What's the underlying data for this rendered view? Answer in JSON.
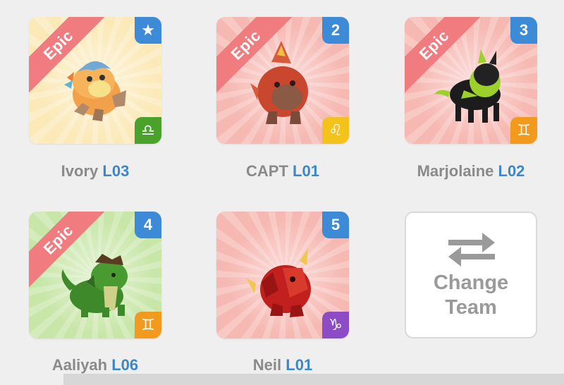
{
  "cards": [
    {
      "name": "Ivory",
      "level": "L03",
      "ribbon": "Epic",
      "badge": "★",
      "zodiac": "♎",
      "bg": "#fbe9b8",
      "badge_color": "#3d8bd6",
      "zodiac_color": "#4aa22c"
    },
    {
      "name": "CAPT",
      "level": "L01",
      "ribbon": "Epic",
      "badge": "2",
      "zodiac": "♌",
      "bg": "#f6b8b2",
      "badge_color": "#3d8bd6",
      "zodiac_color": "#f3c21b"
    },
    {
      "name": "Marjolaine",
      "level": "L02",
      "ribbon": "Epic",
      "badge": "3",
      "zodiac": "♊",
      "bg": "#f6b8b2",
      "badge_color": "#3d8bd6",
      "zodiac_color": "#f29a1e"
    },
    {
      "name": "Aaliyah",
      "level": "L06",
      "ribbon": "Epic",
      "badge": "4",
      "zodiac": "♊",
      "bg": "#c8e6a8",
      "badge_color": "#3d8bd6",
      "zodiac_color": "#f29a1e"
    },
    {
      "name": "Neil",
      "level": "L01",
      "ribbon": "",
      "badge": "5",
      "zodiac": "♑",
      "bg": "#f6b8b2",
      "badge_color": "#3d8bd6",
      "zodiac_color": "#8e4bc6"
    }
  ],
  "change_team": {
    "line1": "Change",
    "line2": "Team",
    "icon": "swap-arrows-icon"
  }
}
